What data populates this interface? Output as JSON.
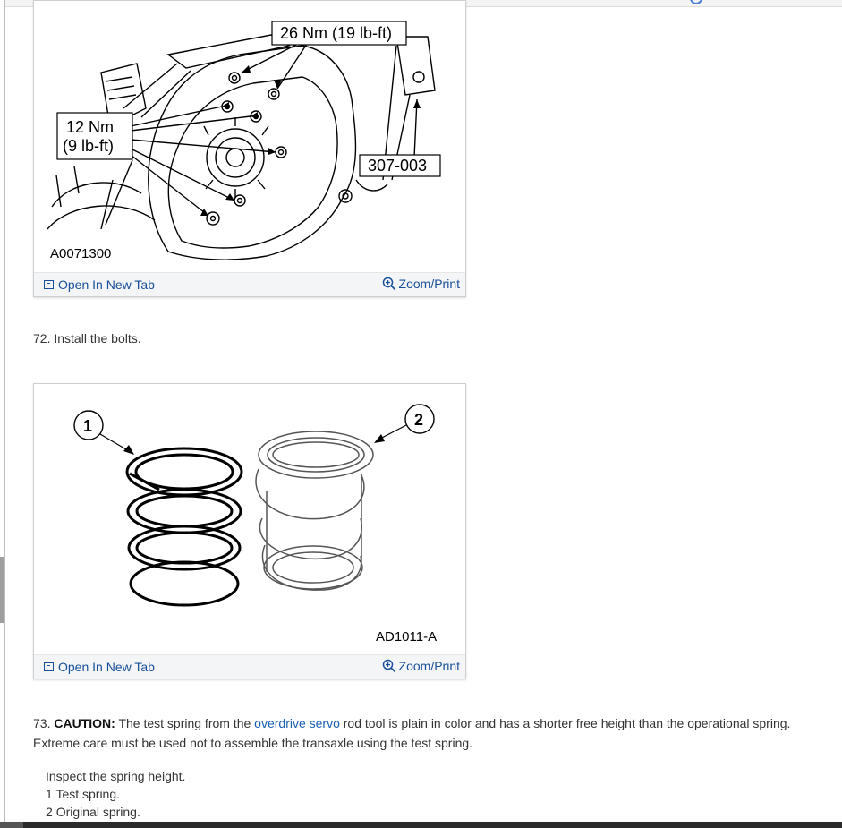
{
  "figure1": {
    "code": "A0071300",
    "torque_top": "26 Nm (19 lb-ft)",
    "torque_left_line1": "12 Nm",
    "torque_left_line2": "(9 lb-ft)",
    "tool": "307-003",
    "open_label": "Open In New Tab",
    "zoom_label": "Zoom/Print"
  },
  "step72": {
    "number": "72.",
    "text": "Install the bolts."
  },
  "figure2": {
    "code": "AD1011-A",
    "callout1": "1",
    "callout2": "2",
    "open_label": "Open In New Tab",
    "zoom_label": "Zoom/Print"
  },
  "step73": {
    "number": "73.",
    "caution": "CAUTION:",
    "text_before_link": "The test spring from the",
    "link": "overdrive servo",
    "text_after_link": "rod tool is plain in color and has a shorter free height than the operational spring.",
    "line2": "Extreme care must be used not to assemble the transaxle using the test spring.",
    "sub_heading": "Inspect the spring height.",
    "items": [
      {
        "num": "1",
        "label": "Test spring."
      },
      {
        "num": "2",
        "label": "Original spring."
      }
    ]
  }
}
